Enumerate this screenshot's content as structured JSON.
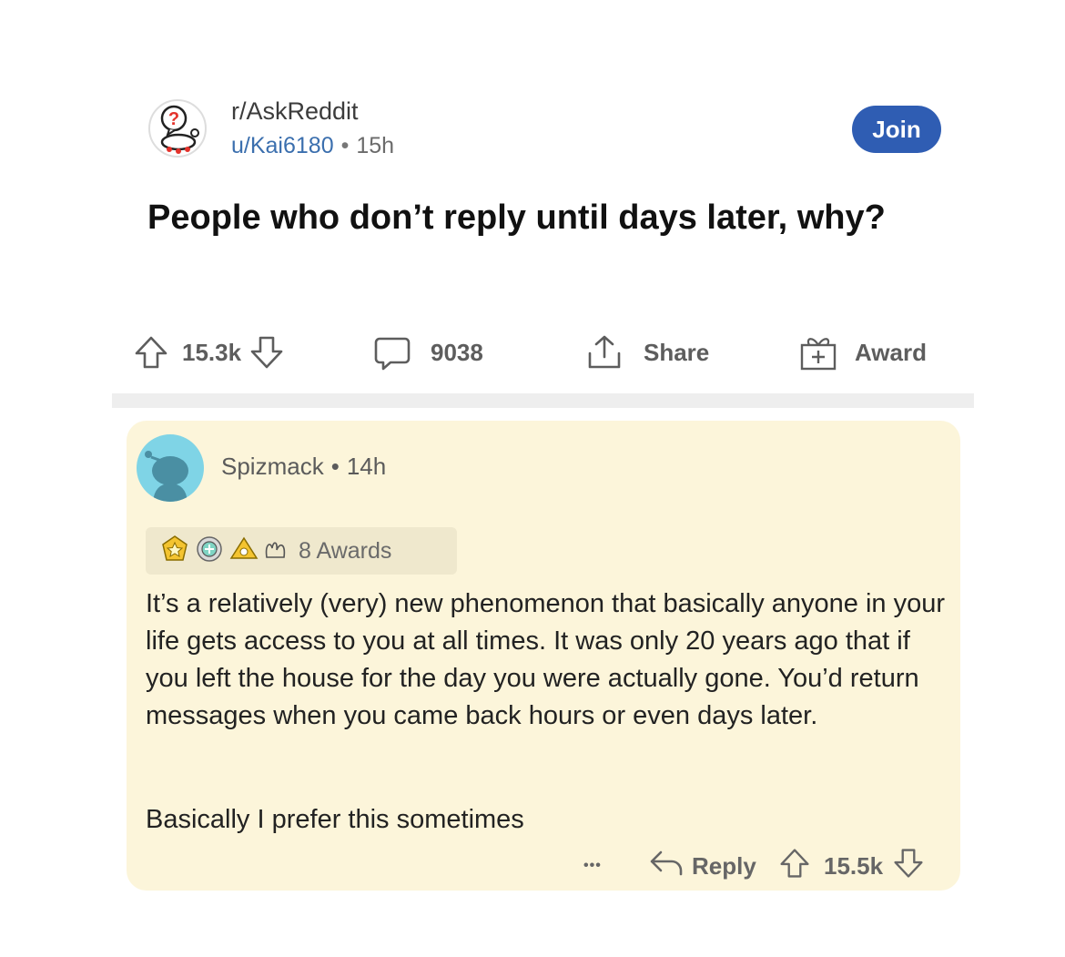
{
  "post": {
    "subreddit": "r/AskReddit",
    "user": "u/Kai6180",
    "separator": "•",
    "age": "15h",
    "join_label": "Join",
    "title": "People who don’t reply until days later, why?"
  },
  "actions": {
    "votes": "15.3k",
    "comments": "9038",
    "share_label": "Share",
    "award_label": "Award"
  },
  "comment": {
    "author": "Spizmack",
    "separator": "•",
    "age": "14h",
    "awards_label": "8 Awards",
    "paragraph1": "It’s a relatively (very) new phenomenon that basically anyone in your life gets access to you at all times. It was only 20 years ago that if you left the house for the day you were actually gone. You’d return messages when you came back hours or even days later.",
    "paragraph2": "Basically I prefer this sometimes",
    "more_label": "•••",
    "reply_label": "Reply",
    "votes": "15.5k"
  },
  "colors": {
    "accent": "#2f5db3",
    "card_bg": "#fcf5da",
    "username": "#3b6fae"
  },
  "icons": [
    "subreddit-icon",
    "upvote-icon",
    "downvote-icon",
    "comment-icon",
    "share-icon",
    "award-icon",
    "avatar",
    "reply-icon",
    "more-icon"
  ]
}
